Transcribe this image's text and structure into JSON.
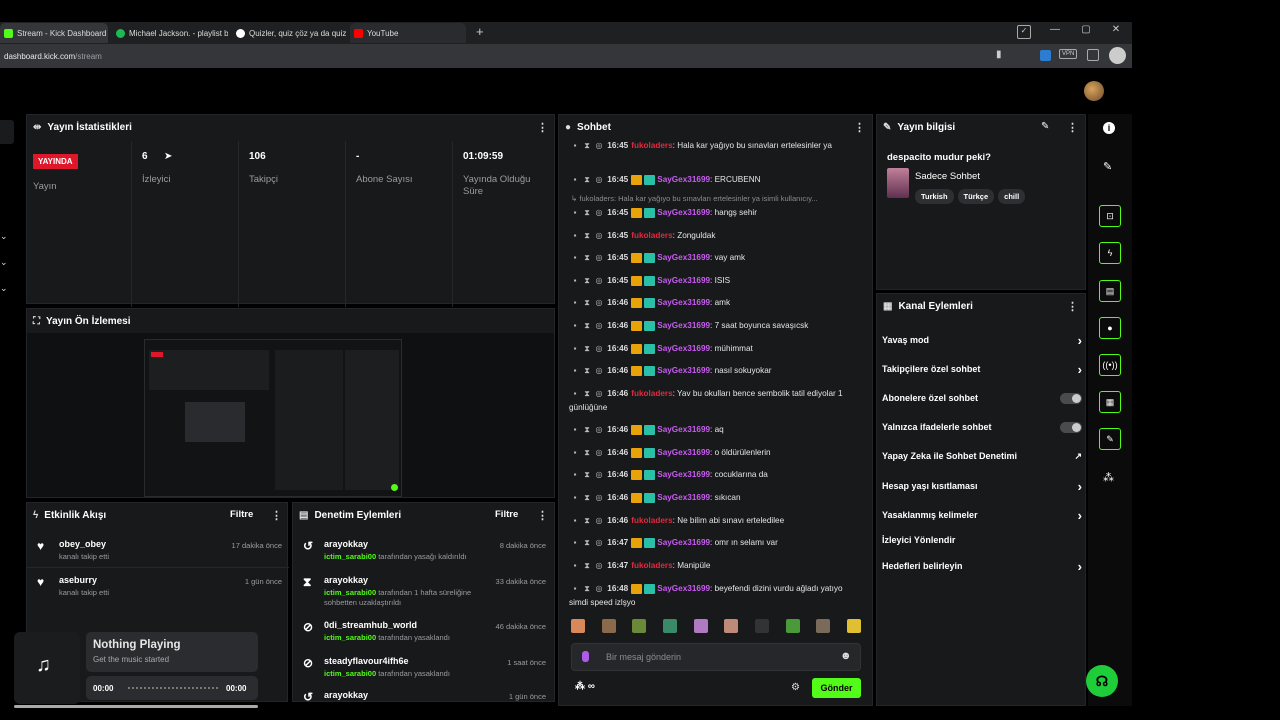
{
  "browser": {
    "tabs": [
      {
        "label": "Stream - Kick Dashboard",
        "color": "#53fc18"
      },
      {
        "label": "Michael Jackson. - playlist b",
        "color": "#1db954"
      },
      {
        "label": "Quizler, quiz çöz ya da quiz",
        "color": "#ffffff"
      },
      {
        "label": "YouTube",
        "color": "#ff0000"
      }
    ],
    "new_tab_icon": "plus-icon",
    "url_host": "dashboard.kick.com",
    "url_path": "/stream",
    "url_prefix": "",
    "vpn_label": "VPN"
  },
  "stats": {
    "title": "Yayın İstatistikleri",
    "live_badge": "YAYINDA",
    "live_label": "Yayın",
    "viewers": "6",
    "viewers_label": "İzleyici",
    "followers": "106",
    "followers_label": "Takipçi",
    "subs": "-",
    "subs_label": "Abone Sayısı",
    "uptime": "01:09:59",
    "uptime_label": "Yayında Olduğu Süre"
  },
  "preview": {
    "title": "Yayın Ön İzlemesi"
  },
  "activity": {
    "title": "Etkinlik Akışı",
    "filter": "Filtre",
    "items": [
      {
        "name": "obey_obey",
        "sub": "kanalı takip etti",
        "time": "17 dakika önce"
      },
      {
        "name": "aseburry",
        "sub": "kanalı takip etti",
        "time": "1 gün önce"
      }
    ]
  },
  "moderation": {
    "title": "Denetim Eylemleri",
    "filter": "Filtre",
    "items": [
      {
        "name": "arayokkay",
        "mod": "ictim_sarabi00",
        "text": " tarafından yasağı kaldırıldı",
        "time": "8 dakika önce"
      },
      {
        "name": "arayokkay",
        "mod": "ictim_sarabi00",
        "text": " tarafından 1 hafta süreliğine sohbetten uzaklaştırıldı",
        "time": "33 dakika önce"
      },
      {
        "name": "0di_streamhub_world",
        "mod": "ictim_sarabi00",
        "text": " tarafından yasaklandı",
        "time": "46 dakika önce"
      },
      {
        "name": "steadyflavour4ifh6e",
        "mod": "ictim_sarabi00",
        "text": " tarafından yasaklandı",
        "time": "1 saat önce"
      },
      {
        "name": "arayokkay",
        "mod": "",
        "text": "",
        "time": "1 gün önce"
      }
    ]
  },
  "music": {
    "title": "Nothing Playing",
    "subtitle": "Get the music started",
    "start": "00:00",
    "end": "00:00"
  },
  "chat": {
    "title": "Sohbet",
    "reply_line": "fukoladers: Hala kar yağıyo bu sınavları ertelesinler ya isimli kullanıcıy...",
    "messages": [
      {
        "time": "16:45",
        "user": "fukoladers",
        "kind": "red",
        "text": ": Hala kar yağıyo bu sınavları ertelesinler ya"
      },
      {
        "time": "16:45",
        "user": "SayGex31699",
        "kind": "purple",
        "text": ": ERCUBENN"
      },
      {
        "time": "16:45",
        "user": "SayGex31699",
        "kind": "purple",
        "text": ": hangş sehir"
      },
      {
        "time": "16:45",
        "user": "fukoladers",
        "kind": "red",
        "text": ": Zonguldak"
      },
      {
        "time": "16:45",
        "user": "SayGex31699",
        "kind": "purple",
        "text": ": vay amk"
      },
      {
        "time": "16:45",
        "user": "SayGex31699",
        "kind": "purple",
        "text": ": ISIS"
      },
      {
        "time": "16:46",
        "user": "SayGex31699",
        "kind": "purple",
        "text": ": amk"
      },
      {
        "time": "16:46",
        "user": "SayGex31699",
        "kind": "purple",
        "text": ": 7 saat boyunca savaşıcsk"
      },
      {
        "time": "16:46",
        "user": "SayGex31699",
        "kind": "purple",
        "text": ": mühimmat"
      },
      {
        "time": "16:46",
        "user": "SayGex31699",
        "kind": "purple",
        "text": ": nasıl sokuyokar"
      },
      {
        "time": "16:46",
        "user": "fukoladers",
        "kind": "red",
        "text": ": Yav bu okulları bence sembolik tatil ediyolar 1 günlüğüne"
      },
      {
        "time": "16:46",
        "user": "SayGex31699",
        "kind": "purple",
        "text": ": aq"
      },
      {
        "time": "16:46",
        "user": "SayGex31699",
        "kind": "purple",
        "text": ": o öldürülenlerin"
      },
      {
        "time": "16:46",
        "user": "SayGex31699",
        "kind": "purple",
        "text": ": cocuklarına da"
      },
      {
        "time": "16:46",
        "user": "SayGex31699",
        "kind": "purple",
        "text": ": sıkıcan"
      },
      {
        "time": "16:46",
        "user": "fukoladers",
        "kind": "red",
        "text": ": Ne bilim abi sınavı erteledilee"
      },
      {
        "time": "16:47",
        "user": "SayGex31699",
        "kind": "purple",
        "text": ": omr ın selamı var"
      },
      {
        "time": "16:47",
        "user": "fukoladers",
        "kind": "red",
        "text": ": Manipüle"
      },
      {
        "time": "16:48",
        "user": "SayGex31699",
        "kind": "purple",
        "text": ": beyefendi dizini vurdu ağladı yatıyo simdi speed izlşyo"
      }
    ],
    "placeholder": "Bir mesaj gönderin",
    "send": "Gönder"
  },
  "info": {
    "title": "Yayın bilgisi",
    "stream_title": "despacito mudur peki?",
    "category": "Sadece Sohbet",
    "tags": [
      "Turkish",
      "Türkçe",
      "chill"
    ]
  },
  "channel_actions": {
    "title": "Kanal Eylemleri",
    "items": [
      {
        "label": "Yavaş mod",
        "control": "chevron"
      },
      {
        "label": "Takipçilere özel sohbet",
        "control": "chevron"
      },
      {
        "label": "Abonelere özel sohbet",
        "control": "toggle"
      },
      {
        "label": "Yalnızca ifadelerle sohbet",
        "control": "toggle"
      },
      {
        "label": "Yapay Zeka ile Sohbet Denetimi",
        "control": "external"
      },
      {
        "label": "Hesap yaşı kısıtlaması",
        "control": "chevron"
      },
      {
        "label": "Yasaklanmış kelimeler",
        "control": "chevron"
      },
      {
        "label": "İzleyici Yönlendir",
        "control": "none"
      },
      {
        "label": "Hedefleri belirleyin",
        "control": "chevron"
      }
    ]
  },
  "colors": {
    "accent": "#53fc18",
    "live": "#e0162b",
    "panel": "#18191b"
  }
}
